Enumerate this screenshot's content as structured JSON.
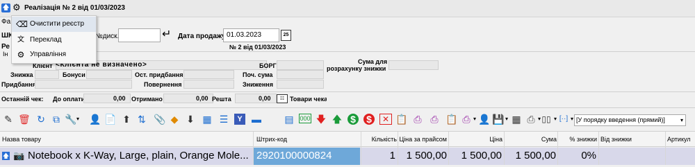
{
  "window": {
    "title": "Реалізація № 2 від 01/03/2023",
    "doc_caption": "№ 2 від 01/03/2023"
  },
  "menu": {
    "items": [
      "Очистити реєстр",
      "Переклад",
      "Управління"
    ]
  },
  "left_fragments": {
    "fa": "Фа",
    "shk": "ШК",
    "re": "Ре",
    "in": "Ін"
  },
  "form": {
    "disc_label": "№диск.",
    "disc_value": "",
    "date_label": "Дата продажу",
    "date_value": "01.03.2023",
    "client_label": "Клієнт",
    "client_value": "<Клієнта не визначено>",
    "debt_label": "БОРГ",
    "sum_for_disc_label_1": "Сума для",
    "sum_for_disc_label_2": "розрахунку знижки",
    "discount_label": "Знижка",
    "bonus_label": "Бонуси",
    "last_purchase_label": "Ост. придбання",
    "start_sum_label": "Поч. сума",
    "purchases_label": "Придбання",
    "returns_label": "Повернення",
    "discounts_label": "Зниження"
  },
  "summary": {
    "last_check_label": "Останній чек:",
    "to_pay_label": "До оплати",
    "to_pay_value": "0,00",
    "received_label": "Отримано",
    "received_value": "0,00",
    "change_label": "Решта",
    "change_value": "0,00",
    "check_goods_label": "Товари чека"
  },
  "toolbar": {
    "sort_value": "[У порядку введення (прямий)]"
  },
  "table": {
    "columns": [
      "Назва товару",
      "Штрих-код",
      "Кількість",
      "Ціна за прайсом",
      "Ціна",
      "Сума",
      "% знижки",
      "Від знижки",
      "Артикул"
    ],
    "rows": [
      {
        "name": "Notebook x K-Way, Large, plain, Orange Mole...",
        "barcode": "2920100000824",
        "qty": "1",
        "list_price": "1 500,00",
        "price": "1 500,00",
        "sum": "1 500,00",
        "disc_pct": "0%",
        "disc_from": "",
        "article": ""
      }
    ]
  }
}
